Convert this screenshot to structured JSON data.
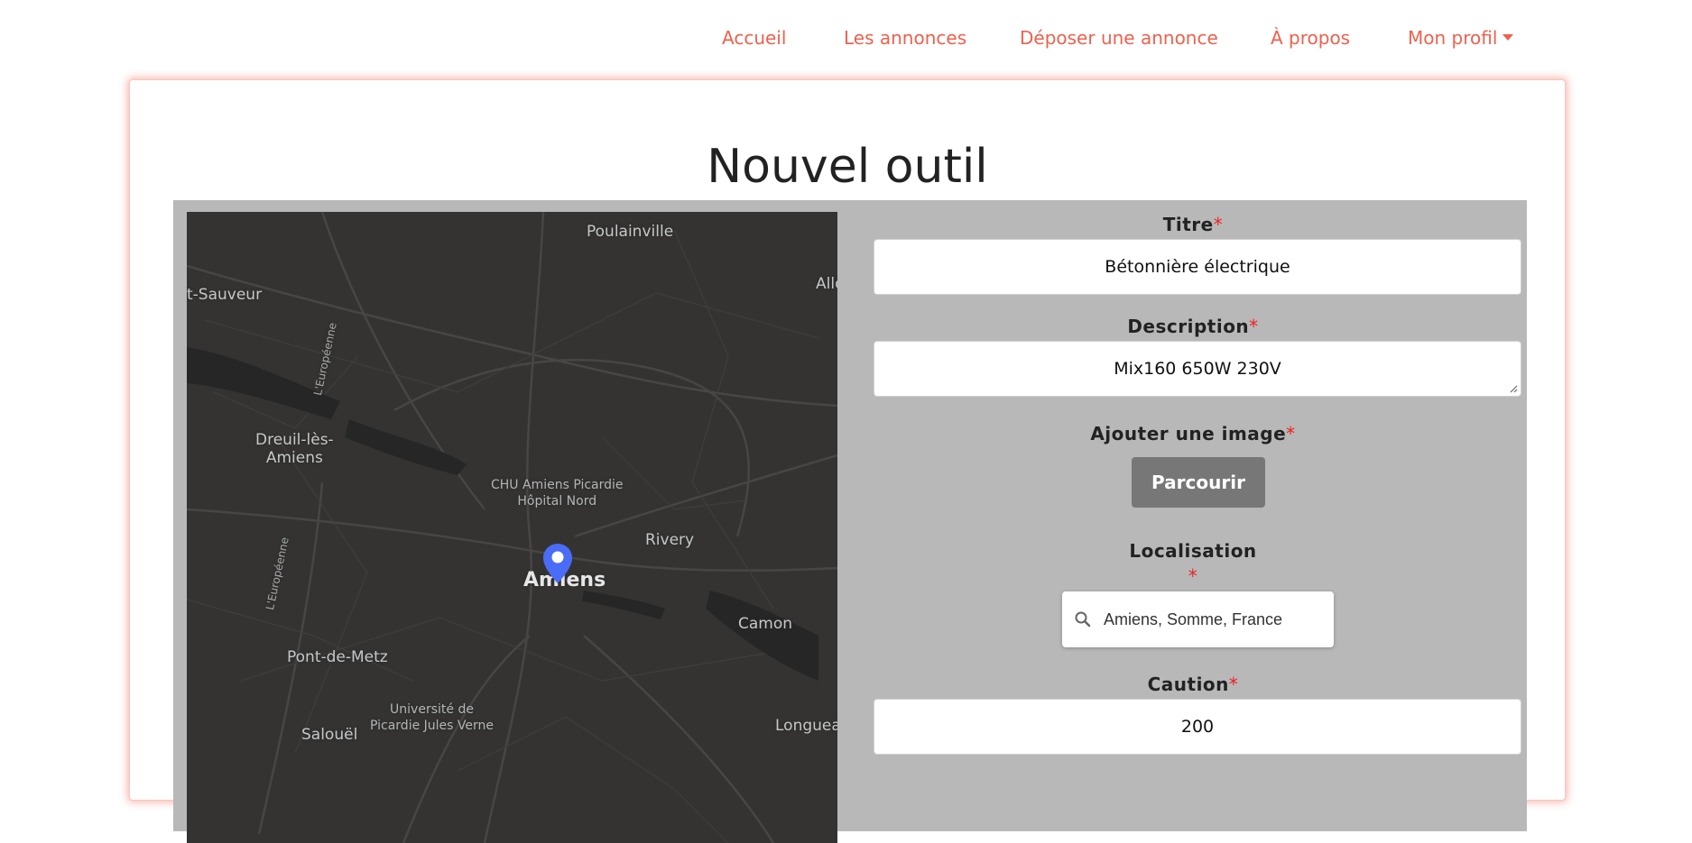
{
  "nav": {
    "items": [
      "Accueil",
      "Les annonces",
      "Déposer une annonce",
      "À propos"
    ],
    "profile": "Mon profil"
  },
  "page_title": "Nouvel outil",
  "form": {
    "title_label": "Titre",
    "title_value": "Bétonnière électrique",
    "description_label": "Description",
    "description_value": "Mix160 650W 230V",
    "image_label": "Ajouter une image",
    "browse_button": "Parcourir",
    "location_label": "Localisation",
    "location_value": "Amiens, Somme, France",
    "deposit_label": "Caution",
    "deposit_value": "200",
    "required_mark": "*"
  },
  "map": {
    "labels": {
      "poulainville": "Poulainville",
      "saint_sauveur": "t-Sauveur",
      "allonville": "Allo",
      "dreuil_1": "Dreuil-lès-",
      "dreuil_2": "Amiens",
      "chu_1": "CHU Amiens Picardie",
      "chu_2": "Hôpital Nord",
      "rivery": "Rivery",
      "amiens": "Amiens",
      "camon": "Camon",
      "pont_de_metz": "Pont-de-Metz",
      "universite_1": "Université de",
      "universite_2": "Picardie Jules Verne",
      "salouel": "Salouël",
      "longueau": "Longuea",
      "leuropeenne_1": "L'Européenne",
      "leuropeenne_2": "L'Européenne"
    },
    "icon": "map-pin-icon"
  },
  "colors": {
    "accent": "#f0604d",
    "panel_bg": "#b8b8b8",
    "map_bg": "#343332",
    "button_bg": "#777777",
    "pin": "#4a6cf7",
    "required": "#ee2222"
  }
}
